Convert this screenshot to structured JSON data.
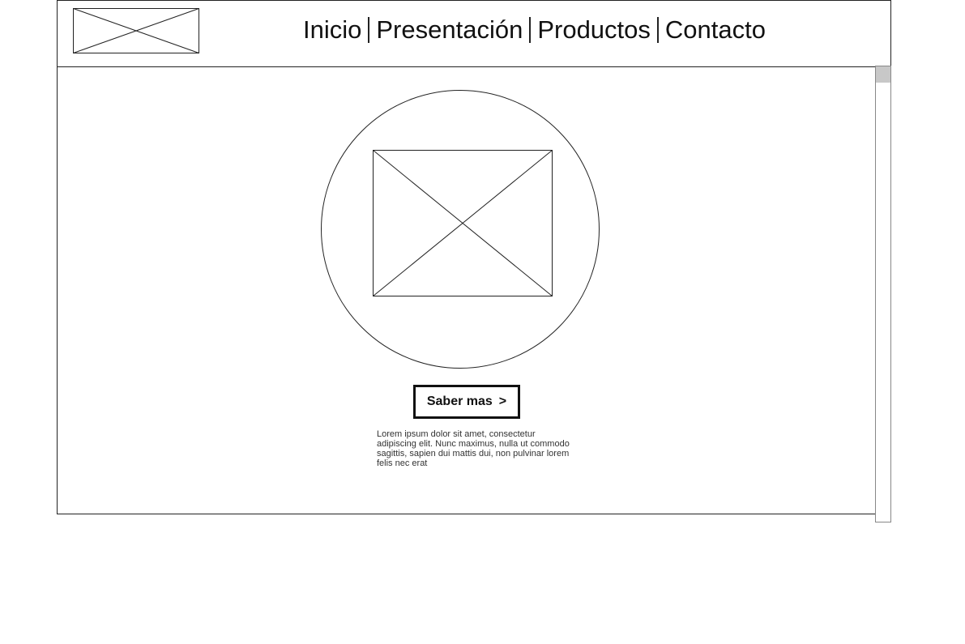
{
  "header": {
    "logo_icon": "image-placeholder-icon",
    "nav": {
      "items": [
        "Inicio",
        "Presentación",
        "Productos",
        "Contacto"
      ]
    }
  },
  "hero": {
    "image_icon": "image-placeholder-icon",
    "cta_label": "Saber mas",
    "cta_arrow": ">",
    "description": "Lorem ipsum dolor sit amet, consectetur adipiscing elit. Nunc maximus, nulla ut commodo sagittis, sapien dui mattis dui, non pulvinar lorem felis nec erat"
  },
  "colors": {
    "stroke": "#222222",
    "background": "#ffffff",
    "scroll_thumb": "#c8c8c8"
  }
}
